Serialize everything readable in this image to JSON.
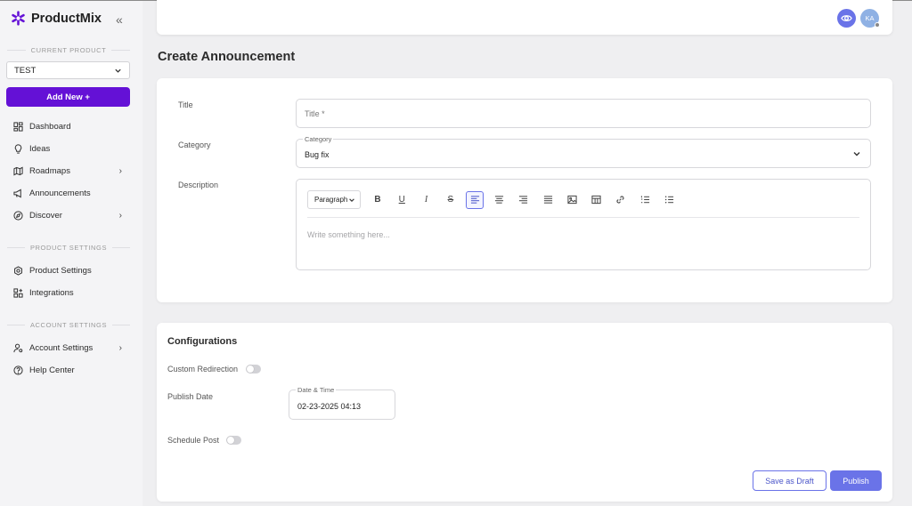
{
  "sidebar": {
    "brand": "ProductMix",
    "collapse_icon": "«",
    "current_product_heading": "CURRENT PRODUCT",
    "product_value": "TEST",
    "add_new_label": "Add New +",
    "items": [
      {
        "label": "Dashboard",
        "icon": "dashboard-icon",
        "has_chevron": false
      },
      {
        "label": "Ideas",
        "icon": "bulb-icon",
        "has_chevron": false
      },
      {
        "label": "Roadmaps",
        "icon": "map-icon",
        "has_chevron": true
      },
      {
        "label": "Announcements",
        "icon": "megaphone-icon",
        "has_chevron": false
      },
      {
        "label": "Discover",
        "icon": "compass-icon",
        "has_chevron": true
      }
    ],
    "product_settings_heading": "PRODUCT SETTINGS",
    "product_settings_items": [
      {
        "label": "Product Settings",
        "icon": "gear-icon"
      },
      {
        "label": "Integrations",
        "icon": "grid-plus-icon"
      }
    ],
    "account_settings_heading": "ACCOUNT SETTINGS",
    "account_settings_items": [
      {
        "label": "Account Settings",
        "icon": "user-gear-icon",
        "has_chevron": true
      },
      {
        "label": "Help Center",
        "icon": "help-icon"
      }
    ]
  },
  "header": {
    "preview_icon": "eye-icon",
    "avatar_initials": "KA"
  },
  "page": {
    "title": "Create Announcement"
  },
  "form": {
    "title_label": "Title",
    "title_placeholder": "Title *",
    "category_label": "Category",
    "category_legend": "Category",
    "category_value": "Bug fix",
    "description_label": "Description",
    "paragraph_select": "Paragraph",
    "editor_placeholder": "Write something here..."
  },
  "config": {
    "title": "Configurations",
    "custom_redirection_label": "Custom Redirection",
    "custom_redirection_on": false,
    "publish_date_label": "Publish Date",
    "date_legend": "Date & Time",
    "date_value": "02-23-2025 04:13",
    "schedule_post_label": "Schedule Post",
    "schedule_post_on": false,
    "save_draft_label": "Save as Draft",
    "publish_label": "Publish"
  },
  "colors": {
    "brand_purple": "#6411d6",
    "accent": "#6a73e8"
  }
}
